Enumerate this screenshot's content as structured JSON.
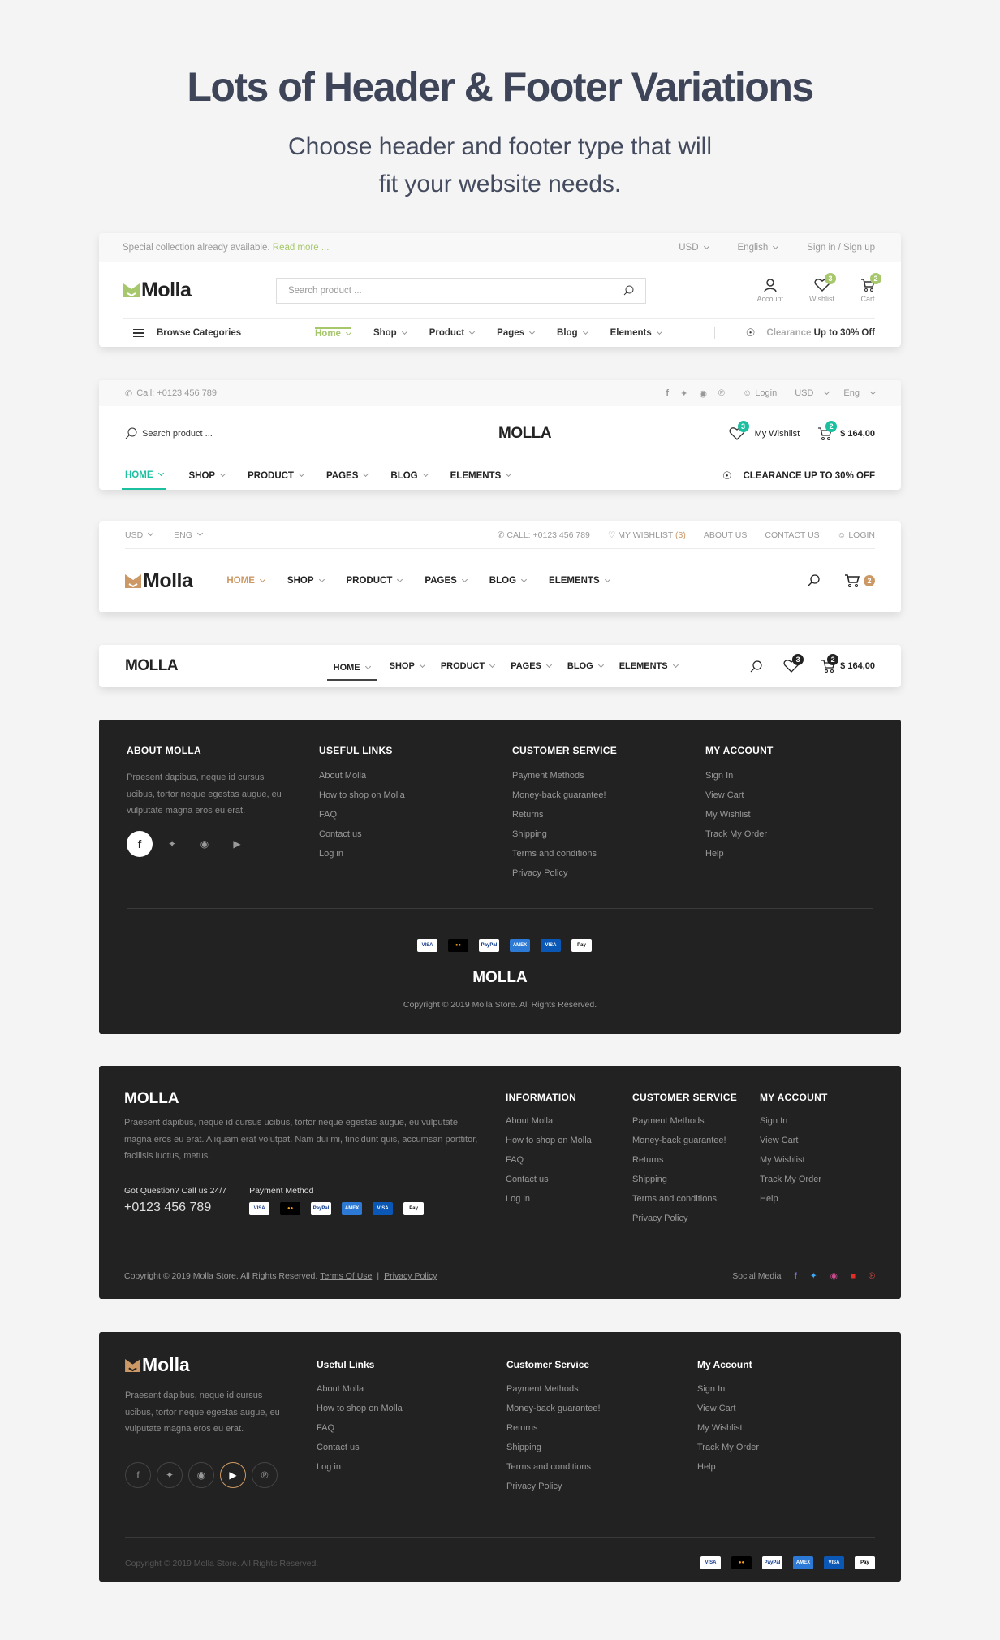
{
  "hero": {
    "title": "Lots of Header & Footer Variations",
    "subtitle_line1": "Choose header and footer type that will",
    "subtitle_line2": "fit your website needs."
  },
  "header1": {
    "announcement": "Special collection already available.",
    "read_more": "Read more ...",
    "currency": "USD",
    "language": "English",
    "signin": "Sign in / Sign up",
    "logo": "Molla",
    "search_placeholder": "Search product ...",
    "account_label": "Account",
    "wishlist_label": "Wishlist",
    "wishlist_count": "3",
    "cart_label": "Cart",
    "cart_count": "2",
    "browse": "Browse Categories",
    "nav": [
      "Home",
      "Shop",
      "Product",
      "Pages",
      "Blog",
      "Elements"
    ],
    "clearance_prefix": "Clearance",
    "clearance_text": "Up to 30% Off",
    "accent": "#a6c76c"
  },
  "header2": {
    "call": "Call: +0123 456 789",
    "login": "Login",
    "currency": "USD",
    "language": "Eng",
    "search_placeholder": "Search product ...",
    "logo": "MOLLA",
    "wishlist_label": "My Wishlist",
    "wishlist_count": "3",
    "cart_count": "2",
    "cart_total": "$ 164,00",
    "nav": [
      "HOME",
      "SHOP",
      "PRODUCT",
      "PAGES",
      "BLOG",
      "ELEMENTS"
    ],
    "clearance": "CLEARANCE UP TO 30% OFF",
    "accent": "#1cc0a0"
  },
  "header3": {
    "currency": "USD",
    "language": "ENG",
    "call": "CALL: +0123 456 789",
    "wishlist": "MY WISHLIST",
    "wishlist_count": "(3)",
    "about": "ABOUT US",
    "contact": "CONTACT US",
    "login": "LOGIN",
    "logo": "Molla",
    "nav": [
      "HOME",
      "SHOP",
      "PRODUCT",
      "PAGES",
      "BLOG",
      "ELEMENTS"
    ],
    "cart_count": "2",
    "accent": "#cc9966"
  },
  "header4": {
    "logo": "MOLLA",
    "nav": [
      "HOME",
      "SHOP",
      "PRODUCT",
      "PAGES",
      "BLOG",
      "ELEMENTS"
    ],
    "wishlist_count": "3",
    "cart_count": "2",
    "cart_total": "$ 164,00"
  },
  "footer1": {
    "about_title": "ABOUT MOLLA",
    "about_text": "Praesent dapibus, neque id cursus ucibus, tortor neque egestas augue, eu vulputate magna eros eu erat.",
    "useful_title": "USEFUL LINKS",
    "useful": [
      "About Molla",
      "How to shop on Molla",
      "FAQ",
      "Contact us",
      "Log in"
    ],
    "service_title": "CUSTOMER SERVICE",
    "service": [
      "Payment Methods",
      "Money-back guarantee!",
      "Returns",
      "Shipping",
      "Terms and conditions",
      "Privacy Policy"
    ],
    "account_title": "MY ACCOUNT",
    "account": [
      "Sign In",
      "View Cart",
      "My Wishlist",
      "Track My Order",
      "Help"
    ],
    "logo": "MOLLA",
    "copyright": "Copyright © 2019 Molla Store. All Rights Reserved."
  },
  "footer2": {
    "logo": "MOLLA",
    "about_text": "Praesent dapibus, neque id cursus ucibus, tortor neque egestas augue, eu vulputate magna eros eu erat. Aliquam erat volutpat. Nam dui mi, tincidunt quis, accumsan porttitor, facilisis luctus, metus.",
    "question": "Got Question? Call us 24/7",
    "phone": "+0123 456 789",
    "payment_label": "Payment Method",
    "info_title": "INFORMATION",
    "info": [
      "About Molla",
      "How to shop on Molla",
      "FAQ",
      "Contact us",
      "Log in"
    ],
    "service_title": "CUSTOMER SERVICE",
    "service": [
      "Payment Methods",
      "Money-back guarantee!",
      "Returns",
      "Shipping",
      "Terms and conditions",
      "Privacy Policy"
    ],
    "account_title": "MY ACCOUNT",
    "account": [
      "Sign In",
      "View Cart",
      "My Wishlist",
      "Track My Order",
      "Help"
    ],
    "copyright": "Copyright © 2019 Molla Store. All Rights Reserved.",
    "terms": "Terms Of Use",
    "divider": "|",
    "privacy": "Privacy Policy",
    "social_label": "Social Media"
  },
  "footer3": {
    "logo": "Molla",
    "about_text": "Praesent dapibus, neque id cursus ucibus, tortor neque egestas augue, eu vulputate magna eros eu erat.",
    "useful_title": "Useful Links",
    "useful": [
      "About Molla",
      "How to shop on Molla",
      "FAQ",
      "Contact us",
      "Log in"
    ],
    "service_title": "Customer Service",
    "service": [
      "Payment Methods",
      "Money-back guarantee!",
      "Returns",
      "Shipping",
      "Terms and conditions",
      "Privacy Policy"
    ],
    "account_title": "My Account",
    "account": [
      "Sign In",
      "View Cart",
      "My Wishlist",
      "Track My Order",
      "Help"
    ],
    "copyright": "Copyright © 2019 Molla Store. All Rights Reserved."
  },
  "payment_cards": [
    "VISA",
    "Mastercard",
    "PayPal",
    "American Express",
    "VISA Electron",
    "Apple Pay"
  ]
}
